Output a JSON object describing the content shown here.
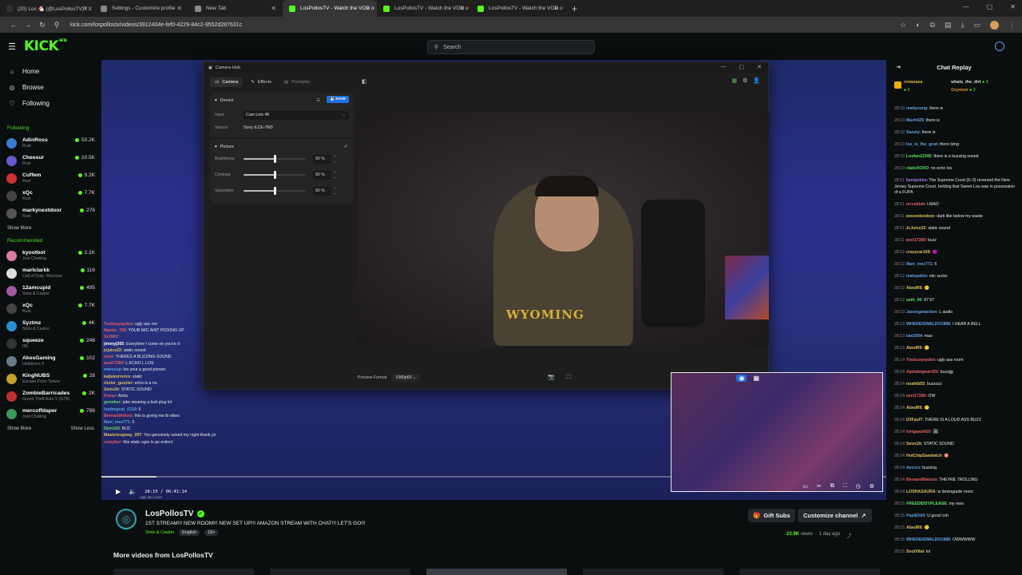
{
  "browser": {
    "tabs": [
      {
        "title": "(20) Los 🐔 (@LosPollosTV) / X",
        "color": "#333"
      },
      {
        "title": "Settings - Customize profile",
        "color": "#888"
      },
      {
        "title": "New Tab",
        "color": "#888"
      },
      {
        "title": "LosPollosTV - Watch the VOD o",
        "color": "#53fc18",
        "active": true
      },
      {
        "title": "LosPollosTV - Watch the VOD o",
        "color": "#53fc18"
      },
      {
        "title": "LosPollosTV - Watch the VOD o",
        "color": "#53fc18"
      }
    ],
    "url": "kick.com/lospollostv/videos/3912404e-fef0-4229-84c2-9552d287631c"
  },
  "header": {
    "logo": "KICK",
    "beta": "BETA",
    "search_placeholder": "Search"
  },
  "sidebar": {
    "nav": [
      {
        "label": "Home",
        "icon": "home-icon"
      },
      {
        "label": "Browse",
        "icon": "compass-icon"
      },
      {
        "label": "Following",
        "icon": "heart-icon"
      }
    ],
    "following_title": "Following",
    "following": [
      {
        "name": "AdinRoss",
        "category": "Rust",
        "viewers": "50.2K",
        "color": "#3b7bd4"
      },
      {
        "name": "Cheesur",
        "category": "Rust",
        "viewers": "10.5K",
        "color": "#6a5acd"
      },
      {
        "name": "Cuffem",
        "category": "Rust",
        "viewers": "9.2K",
        "color": "#c33"
      },
      {
        "name": "xQc",
        "category": "Rust",
        "viewers": "7.7K",
        "color": "#444"
      },
      {
        "name": "markynextdoor",
        "category": "Rust",
        "viewers": "276",
        "color": "#555"
      }
    ],
    "show_more": "Show More",
    "recommended_title": "Recommended",
    "recommended": [
      {
        "name": "kyootbot",
        "category": "Just Chatting",
        "viewers": "2.1K",
        "color": "#e07aa0"
      },
      {
        "name": "marlclarkk",
        "category": "Call of Duty: Warzone",
        "viewers": "116",
        "color": "#ddd"
      },
      {
        "name": "12amcupid",
        "category": "Slots & Casino",
        "viewers": "495",
        "color": "#a05aa0"
      },
      {
        "name": "xQc",
        "category": "Rust",
        "viewers": "7.7K",
        "color": "#444"
      },
      {
        "name": "Syztmz",
        "category": "Slots & Casino",
        "viewers": "4K",
        "color": "#2a8fd0"
      },
      {
        "name": "squeeze",
        "category": "IRL",
        "viewers": "246",
        "color": "#333"
      },
      {
        "name": "AkesGaming",
        "category": "Helldivers II",
        "viewers": "102",
        "color": "#6a7a8a"
      },
      {
        "name": "KingNUBS",
        "category": "Escape From Tarkov",
        "viewers": "28",
        "color": "#c8a030"
      },
      {
        "name": "ZombieBarricades",
        "category": "Grand Theft Auto V (GTA)",
        "viewers": "2K",
        "color": "#c03030"
      },
      {
        "name": "mercoffdaper",
        "category": "Just Chatting",
        "viewers": "786",
        "color": "#3a9a5a"
      }
    ],
    "show_more2": "Show More",
    "show_less": "Show Less"
  },
  "video_chat": [
    {
      "u": "Toobusyayden",
      "c": "#e06060",
      "m": "ugly ass roo"
    },
    {
      "u": "Nando_760",
      "c": "#e06060",
      "m": "YOUR MIC AINT PICKING UP"
    },
    {
      "u": "1k1993",
      "c": "#e06060",
      "m": ""
    },
    {
      "u": "jimmyj305",
      "c": "#fff",
      "m": "Everytime I come on you're d"
    },
    {
      "u": "jcjuice22",
      "c": "#e0c060",
      "m": "static sound"
    },
    {
      "u": "luzer",
      "c": "#e06060",
      "m": "THERES A BUZZING SOUND"
    },
    {
      "u": "axel17280",
      "c": "#e06060",
      "m": "L ECHO L LOS"
    },
    {
      "u": "marcusp",
      "c": "#60a0e0",
      "m": "los your a good person"
    },
    {
      "u": "kaljukorrenrn",
      "c": "#e0c060",
      "m": "static"
    },
    {
      "u": "rizzler_guzzler",
      "c": "#e0c060",
      "m": "echo is a no"
    },
    {
      "u": "Seize2k",
      "c": "#e0c060",
      "m": "STATIC SOUND"
    },
    {
      "u": "Posse",
      "c": "#e06060",
      "m": "Anita"
    },
    {
      "u": "goonher",
      "c": "#60e060",
      "m": "jake wearing a butt plug lol"
    },
    {
      "u": "losthegoat_0319",
      "c": "#60a0e0",
      "m": "6"
    },
    {
      "u": "BernardAtkins",
      "c": "#e06060",
      "m": "this is giving me tb vibes"
    },
    {
      "u": "Mart_inez771",
      "c": "#60a0e0",
      "m": "6"
    },
    {
      "u": "Djsn100",
      "c": "#60e060",
      "m": "BUZ"
    },
    {
      "u": "Mastereogway_097",
      "c": "#e0c060",
      "m": "You genuinely ruined my night thank yo"
    },
    {
      "u": "crazykor",
      "c": "#e06060",
      "m": "this static sgre is go extinct"
    }
  ],
  "player": {
    "time": "28:15 / 06:41:14",
    "overlay_text": "ugly ass room",
    "progress_fraction": 0.07
  },
  "camhub": {
    "title": "Camera Hub",
    "tabs": [
      {
        "label": "Camera",
        "active": true
      },
      {
        "label": "Effects"
      },
      {
        "label": "Prompter",
        "dim": true
      }
    ],
    "device_section": "Device",
    "save": "SAVE",
    "input_label": "Input",
    "input_value": "Cam Link 4K",
    "source_label": "Source",
    "source_value": "Sony ILCE-7M3",
    "picture_section": "Picture",
    "sliders": [
      {
        "label": "Brightness",
        "value": "50 %",
        "fraction": 0.5
      },
      {
        "label": "Contrast",
        "value": "50 %",
        "fraction": 0.5
      },
      {
        "label": "Saturation",
        "value": "50 %",
        "fraction": 0.5
      }
    ],
    "preview_format_label": "Preview Format",
    "preview_format_value": "1080p60",
    "shirt_text": "WYOMING"
  },
  "channel": {
    "name": "LosPollosTV",
    "title": "1ST STREAM!!! NEW ROOM!!! NEW SET UP!!! AMAZON STREAM WITH CHAT!!! LET'S GO!!!",
    "category": "Slots & Casino",
    "tags": [
      "English",
      "18+"
    ],
    "gift_subs": "Gift Subs",
    "customize": "Customize channel",
    "views": "23.9K",
    "views_label": "views",
    "age": "1 day ago",
    "more_videos": "More videos from LosPollosTV"
  },
  "chat": {
    "title": "Chat Replay",
    "gifters": [
      {
        "name": "crewzaza",
        "count": "5",
        "color": "#e0c030"
      },
      {
        "name": "whats_the_dirt",
        "count": "3",
        "color": "#ddd"
      },
      {
        "name": "Oxymoir",
        "count": "2",
        "color": "#e09030"
      }
    ],
    "messages": [
      {
        "t": "28:10",
        "u": "mattyxung",
        "c": "#60a0e0",
        "m": "there is"
      },
      {
        "t": "28:10",
        "u": "Maxh425",
        "c": "#60a0e0",
        "m": "there is"
      },
      {
        "t": "28:10",
        "u": "Sacety",
        "c": "#60a0e0",
        "m": "there is"
      },
      {
        "t": "28:10",
        "u": "los_is_the_goat",
        "c": "#60a0e0",
        "m": "there lying"
      },
      {
        "t": "28:10",
        "u": "Losfan12345",
        "c": "#60e060",
        "m": "there is a buzzing sound"
      },
      {
        "t": "28:10",
        "u": "clakeXOXO",
        "c": "#60e060",
        "m": "no echo los"
      },
      {
        "t": "28:11",
        "u": "hardpekka",
        "c": "#a070e0",
        "m": "The Supreme Court (6–3) reversed the New Jersey Supreme Court, holding that Sweet Lou was in possession of a FUPA"
      },
      {
        "t": "28:11",
        "u": "urrealdab",
        "c": "#e06060",
        "m": "LMAO"
      },
      {
        "t": "28:11",
        "u": "zeezeebooboo",
        "c": "#e0c060",
        "m": "dark like below my waste"
      },
      {
        "t": "28:11",
        "u": "JcJuice22",
        "c": "#e0c060",
        "m": "static sound"
      },
      {
        "t": "28:11",
        "u": "axel17280",
        "c": "#e06060",
        "m": "buzz"
      },
      {
        "t": "28:12",
        "u": "crazycar169",
        "c": "#e0c060",
        "m": "😈"
      },
      {
        "t": "28:12",
        "u": "Mart_inez771",
        "c": "#60a0e0",
        "m": "6"
      },
      {
        "t": "28:12",
        "u": "malopablo",
        "c": "#60a0e0",
        "m": "mic sucks"
      },
      {
        "t": "28:12",
        "u": "AbedR6",
        "c": "#e0c060",
        "m": "😶"
      },
      {
        "t": "28:12",
        "u": "seth_06",
        "c": "#60e060",
        "m": "67 67"
      },
      {
        "t": "28:13",
        "u": "Jaxongotaction",
        "c": "#60a0e0",
        "m": "L audio"
      },
      {
        "t": "28:13",
        "u": "WHEREISWALDO1988",
        "c": "#60a0e0",
        "m": "I HEAR A BELL"
      },
      {
        "t": "28:13",
        "u": "law2004",
        "c": "#60a0e0",
        "m": "mao"
      },
      {
        "t": "28:13",
        "u": "AbedR6",
        "c": "#e0c060",
        "m": "😶"
      },
      {
        "t": "28:14",
        "u": "Toobusyayden",
        "c": "#e06060",
        "m": "ugly ass room"
      },
      {
        "t": "28:14",
        "u": "Alphabigwar420",
        "c": "#e06060",
        "m": "buzzjjg"
      },
      {
        "t": "28:14",
        "u": "noahtb55",
        "c": "#e0c060",
        "m": "buzzzzz"
      },
      {
        "t": "28:14",
        "u": "axel17280",
        "c": "#e06060",
        "m": "OW"
      },
      {
        "t": "28:14",
        "u": "AbedR6",
        "c": "#e0c060",
        "m": "😶"
      },
      {
        "t": "28:14",
        "u": "D3FaulT",
        "c": "#e0c060",
        "m": "THERE IS A LOUD ASS BUZZ"
      },
      {
        "t": "28:14",
        "u": "fortgawd420",
        "c": "#e06060",
        "m": "🖼"
      },
      {
        "t": "28:14",
        "u": "Seize2k",
        "c": "#e0c060",
        "m": "STATIC SOUND"
      },
      {
        "t": "28:14",
        "u": "HotChipSandwich",
        "c": "#e0c060",
        "m": "🎯"
      },
      {
        "t": "28:14",
        "u": "Aezorx",
        "c": "#60a0e0",
        "m": "buzzing"
      },
      {
        "t": "28:14",
        "u": "BernardWatson",
        "c": "#e06060",
        "m": "THEYRE TROLLING"
      },
      {
        "t": "28:14",
        "u": "LOSHASAURA",
        "c": "#e0c060",
        "m": "w downgrade room"
      },
      {
        "t": "28:15",
        "u": "FREEDIDDYPLEASE",
        "c": "#60e060",
        "m": "my ears"
      },
      {
        "t": "28:15",
        "u": "PapiEhlili",
        "c": "#60a0e0",
        "m": "U good cuh"
      },
      {
        "t": "28:15",
        "u": "AbedR6",
        "c": "#e0c060",
        "m": "😶"
      },
      {
        "t": "28:15",
        "u": "WHEREISWALDO1988",
        "c": "#60a0e0",
        "m": "OWWWWW"
      },
      {
        "t": "28:15",
        "u": "SoulVital",
        "c": "#e0c060",
        "m": "lol"
      }
    ]
  }
}
